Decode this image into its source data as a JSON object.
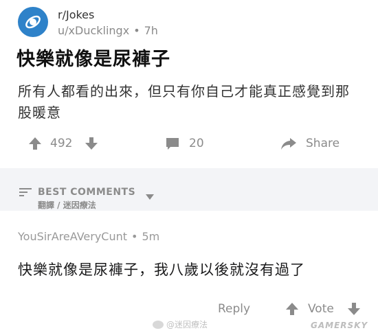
{
  "post": {
    "subreddit": "r/Jokes",
    "author": "u/xDucklingx",
    "separator": "•",
    "age": "7h",
    "title": "快樂就像是尿褲子",
    "body": "所有人都看的出來，但只有你自己才能真正感覺到那股暖意",
    "score": "492",
    "comments": "20",
    "share_label": "Share"
  },
  "comments_header": {
    "sort_label": "BEST COMMENTS",
    "credit": "翻譯 / 迷因療法"
  },
  "comment": {
    "author": "YouSirAreAVeryCunt",
    "separator": "•",
    "age": "5m",
    "body": "快樂就像是尿褲子，我八歲以後就沒有過了",
    "reply_label": "Reply",
    "vote_label": "Vote"
  },
  "watermark": {
    "text": "@迷因療法",
    "brand": "GAMERSKY"
  },
  "colors": {
    "avatar_blue": "#2e82c9",
    "icon_gray": "#8b8b8b",
    "divider_bg": "#f3f4f7"
  },
  "icons": [
    "subreddit-avatar-icon",
    "upvote-icon",
    "downvote-icon",
    "comment-icon",
    "share-icon",
    "sort-icon",
    "caret-down-icon"
  ]
}
